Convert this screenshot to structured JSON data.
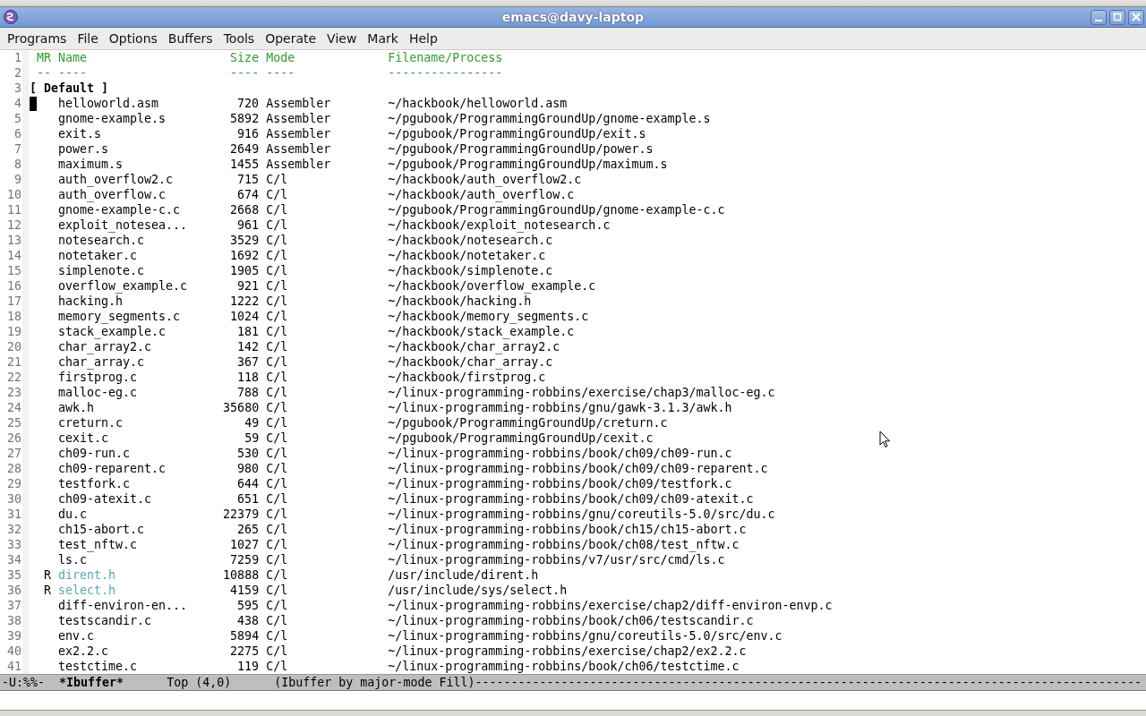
{
  "window": {
    "title": "emacs@davy-laptop"
  },
  "menu": [
    "Programs",
    "File",
    "Options",
    "Buffers",
    "Tools",
    "Operate",
    "View",
    "Mark",
    "Help"
  ],
  "header": {
    "lines": [
      "1",
      "2"
    ],
    "mr": "MR",
    "name": "Name",
    "size": "Size",
    "mode": "Mode",
    "filename": "Filename/Process",
    "mr_rule": "--",
    "name_rule": "----",
    "size_rule": "----",
    "mode_rule": "----",
    "filename_rule": "----------------"
  },
  "group": {
    "line": "3",
    "label": "[ Default ]"
  },
  "rows": [
    {
      "line": "4",
      "flag": "",
      "name": "helloworld.asm",
      "size": "720",
      "mode": "Assembler",
      "filename": "~/hackbook/helloworld.asm",
      "read_only": false,
      "cursor": true
    },
    {
      "line": "5",
      "flag": "",
      "name": "gnome-example.s",
      "size": "5892",
      "mode": "Assembler",
      "filename": "~/pgubook/ProgrammingGroundUp/gnome-example.s",
      "read_only": false,
      "cursor": false
    },
    {
      "line": "6",
      "flag": "",
      "name": "exit.s",
      "size": "916",
      "mode": "Assembler",
      "filename": "~/pgubook/ProgrammingGroundUp/exit.s",
      "read_only": false,
      "cursor": false
    },
    {
      "line": "7",
      "flag": "",
      "name": "power.s",
      "size": "2649",
      "mode": "Assembler",
      "filename": "~/pgubook/ProgrammingGroundUp/power.s",
      "read_only": false,
      "cursor": false
    },
    {
      "line": "8",
      "flag": "",
      "name": "maximum.s",
      "size": "1455",
      "mode": "Assembler",
      "filename": "~/pgubook/ProgrammingGroundUp/maximum.s",
      "read_only": false,
      "cursor": false
    },
    {
      "line": "9",
      "flag": "",
      "name": "auth_overflow2.c",
      "size": "715",
      "mode": "C/l",
      "filename": "~/hackbook/auth_overflow2.c",
      "read_only": false,
      "cursor": false
    },
    {
      "line": "10",
      "flag": "",
      "name": "auth_overflow.c",
      "size": "674",
      "mode": "C/l",
      "filename": "~/hackbook/auth_overflow.c",
      "read_only": false,
      "cursor": false
    },
    {
      "line": "11",
      "flag": "",
      "name": "gnome-example-c.c",
      "size": "2668",
      "mode": "C/l",
      "filename": "~/pgubook/ProgrammingGroundUp/gnome-example-c.c",
      "read_only": false,
      "cursor": false
    },
    {
      "line": "12",
      "flag": "",
      "name": "exploit_notesea...",
      "size": "961",
      "mode": "C/l",
      "filename": "~/hackbook/exploit_notesearch.c",
      "read_only": false,
      "cursor": false
    },
    {
      "line": "13",
      "flag": "",
      "name": "notesearch.c",
      "size": "3529",
      "mode": "C/l",
      "filename": "~/hackbook/notesearch.c",
      "read_only": false,
      "cursor": false
    },
    {
      "line": "14",
      "flag": "",
      "name": "notetaker.c",
      "size": "1692",
      "mode": "C/l",
      "filename": "~/hackbook/notetaker.c",
      "read_only": false,
      "cursor": false
    },
    {
      "line": "15",
      "flag": "",
      "name": "simplenote.c",
      "size": "1905",
      "mode": "C/l",
      "filename": "~/hackbook/simplenote.c",
      "read_only": false,
      "cursor": false
    },
    {
      "line": "16",
      "flag": "",
      "name": "overflow_example.c",
      "size": "921",
      "mode": "C/l",
      "filename": "~/hackbook/overflow_example.c",
      "read_only": false,
      "cursor": false
    },
    {
      "line": "17",
      "flag": "",
      "name": "hacking.h",
      "size": "1222",
      "mode": "C/l",
      "filename": "~/hackbook/hacking.h",
      "read_only": false,
      "cursor": false
    },
    {
      "line": "18",
      "flag": "",
      "name": "memory_segments.c",
      "size": "1024",
      "mode": "C/l",
      "filename": "~/hackbook/memory_segments.c",
      "read_only": false,
      "cursor": false
    },
    {
      "line": "19",
      "flag": "",
      "name": "stack_example.c",
      "size": "181",
      "mode": "C/l",
      "filename": "~/hackbook/stack_example.c",
      "read_only": false,
      "cursor": false
    },
    {
      "line": "20",
      "flag": "",
      "name": "char_array2.c",
      "size": "142",
      "mode": "C/l",
      "filename": "~/hackbook/char_array2.c",
      "read_only": false,
      "cursor": false
    },
    {
      "line": "21",
      "flag": "",
      "name": "char_array.c",
      "size": "367",
      "mode": "C/l",
      "filename": "~/hackbook/char_array.c",
      "read_only": false,
      "cursor": false
    },
    {
      "line": "22",
      "flag": "",
      "name": "firstprog.c",
      "size": "118",
      "mode": "C/l",
      "filename": "~/hackbook/firstprog.c",
      "read_only": false,
      "cursor": false
    },
    {
      "line": "23",
      "flag": "",
      "name": "malloc-eg.c",
      "size": "788",
      "mode": "C/l",
      "filename": "~/linux-programming-robbins/exercise/chap3/malloc-eg.c",
      "read_only": false,
      "cursor": false
    },
    {
      "line": "24",
      "flag": "",
      "name": "awk.h",
      "size": "35680",
      "mode": "C/l",
      "filename": "~/linux-programming-robbins/gnu/gawk-3.1.3/awk.h",
      "read_only": false,
      "cursor": false
    },
    {
      "line": "25",
      "flag": "",
      "name": "creturn.c",
      "size": "49",
      "mode": "C/l",
      "filename": "~/pgubook/ProgrammingGroundUp/creturn.c",
      "read_only": false,
      "cursor": false
    },
    {
      "line": "26",
      "flag": "",
      "name": "cexit.c",
      "size": "59",
      "mode": "C/l",
      "filename": "~/pgubook/ProgrammingGroundUp/cexit.c",
      "read_only": false,
      "cursor": false
    },
    {
      "line": "27",
      "flag": "",
      "name": "ch09-run.c",
      "size": "530",
      "mode": "C/l",
      "filename": "~/linux-programming-robbins/book/ch09/ch09-run.c",
      "read_only": false,
      "cursor": false
    },
    {
      "line": "28",
      "flag": "",
      "name": "ch09-reparent.c",
      "size": "980",
      "mode": "C/l",
      "filename": "~/linux-programming-robbins/book/ch09/ch09-reparent.c",
      "read_only": false,
      "cursor": false
    },
    {
      "line": "29",
      "flag": "",
      "name": "testfork.c",
      "size": "644",
      "mode": "C/l",
      "filename": "~/linux-programming-robbins/book/ch09/testfork.c",
      "read_only": false,
      "cursor": false
    },
    {
      "line": "30",
      "flag": "",
      "name": "ch09-atexit.c",
      "size": "651",
      "mode": "C/l",
      "filename": "~/linux-programming-robbins/book/ch09/ch09-atexit.c",
      "read_only": false,
      "cursor": false
    },
    {
      "line": "31",
      "flag": "",
      "name": "du.c",
      "size": "22379",
      "mode": "C/l",
      "filename": "~/linux-programming-robbins/gnu/coreutils-5.0/src/du.c",
      "read_only": false,
      "cursor": false
    },
    {
      "line": "32",
      "flag": "",
      "name": "ch15-abort.c",
      "size": "265",
      "mode": "C/l",
      "filename": "~/linux-programming-robbins/book/ch15/ch15-abort.c",
      "read_only": false,
      "cursor": false
    },
    {
      "line": "33",
      "flag": "",
      "name": "test_nftw.c",
      "size": "1027",
      "mode": "C/l",
      "filename": "~/linux-programming-robbins/book/ch08/test_nftw.c",
      "read_only": false,
      "cursor": false
    },
    {
      "line": "34",
      "flag": "",
      "name": "ls.c",
      "size": "7259",
      "mode": "C/l",
      "filename": "~/linux-programming-robbins/v7/usr/src/cmd/ls.c",
      "read_only": false,
      "cursor": false
    },
    {
      "line": "35",
      "flag": "R",
      "name": "dirent.h",
      "size": "10888",
      "mode": "C/l",
      "filename": "/usr/include/dirent.h",
      "read_only": true,
      "cursor": false
    },
    {
      "line": "36",
      "flag": "R",
      "name": "select.h",
      "size": "4159",
      "mode": "C/l",
      "filename": "/usr/include/sys/select.h",
      "read_only": true,
      "cursor": false
    },
    {
      "line": "37",
      "flag": "",
      "name": "diff-environ-en...",
      "size": "595",
      "mode": "C/l",
      "filename": "~/linux-programming-robbins/exercise/chap2/diff-environ-envp.c",
      "read_only": false,
      "cursor": false
    },
    {
      "line": "38",
      "flag": "",
      "name": "testscandir.c",
      "size": "438",
      "mode": "C/l",
      "filename": "~/linux-programming-robbins/book/ch06/testscandir.c",
      "read_only": false,
      "cursor": false
    },
    {
      "line": "39",
      "flag": "",
      "name": "env.c",
      "size": "5894",
      "mode": "C/l",
      "filename": "~/linux-programming-robbins/gnu/coreutils-5.0/src/env.c",
      "read_only": false,
      "cursor": false
    },
    {
      "line": "40",
      "flag": "",
      "name": "ex2.2.c",
      "size": "2275",
      "mode": "C/l",
      "filename": "~/linux-programming-robbins/exercise/chap2/ex2.2.c",
      "read_only": false,
      "cursor": false
    },
    {
      "line": "41",
      "flag": "",
      "name": "testctime.c",
      "size": "119",
      "mode": "C/l",
      "filename": "~/linux-programming-robbins/book/ch06/testctime.c",
      "read_only": false,
      "cursor": false
    }
  ],
  "mode_line": {
    "status": "-U:%%-",
    "buffer": "*Ibuffer*",
    "position": "Top (4,0)",
    "modes": "(Ibuffer by major-mode Fill)",
    "fill": "---------------------------------------------------------------------------------------------"
  }
}
